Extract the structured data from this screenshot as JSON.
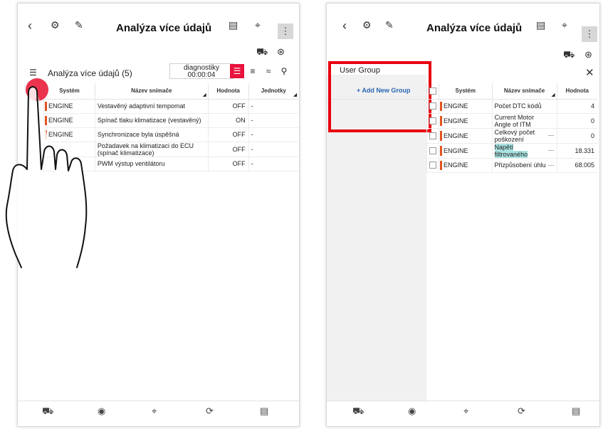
{
  "app": {
    "title": "Analýza více údajů"
  },
  "left": {
    "toolbar": {
      "section_label": "Analýza více údajů (5)",
      "diagnostics_label": "diagnostiky",
      "timer": "00:00:04"
    },
    "table": {
      "columns": [
        "Systém",
        "Název snímače",
        "Hodnota",
        "Jednotky"
      ],
      "rows": [
        {
          "system": "ENGINE",
          "sensor": "Vestavěný adaptivní tempomat",
          "value": "OFF",
          "unit": "-"
        },
        {
          "system": "ENGINE",
          "sensor": "Spínač tlaku klimatizace (vestavěný)",
          "value": "ON",
          "unit": "-"
        },
        {
          "system": "ENGINE",
          "sensor": "Synchronizace byla úspěšná",
          "value": "OFF",
          "unit": "-"
        },
        {
          "system": "",
          "sensor": "Požadavek na klimatizaci do ECU (spínač klimatizace)",
          "value": "OFF",
          "unit": "-"
        },
        {
          "system": "",
          "sensor": "PWM výstup ventilátoru",
          "value": "OFF",
          "unit": "-"
        }
      ]
    }
  },
  "right": {
    "user_group": {
      "title": "User Group",
      "add_label": "+ Add New Group"
    },
    "table": {
      "columns": [
        "Systém",
        "Název snímače",
        "Hodnota"
      ],
      "rows": [
        {
          "system": "ENGINE",
          "sensor": "Počet DTC kódů",
          "value": "4"
        },
        {
          "system": "ENGINE",
          "sensor": "Current Motor Angle of ITM",
          "value": "0"
        },
        {
          "system": "ENGINE",
          "sensor": "Celkový počet poškození",
          "value": "0"
        },
        {
          "system": "ENGINE",
          "sensor": "Napětí filtrovaného",
          "value": "18.331"
        },
        {
          "system": "ENGINE",
          "sensor": "Přizpůsobení úhlu",
          "value": "68.005"
        }
      ]
    }
  },
  "icons": {
    "back": "back-arrow-icon",
    "diagnostics": "diagnostic-gauge-icon",
    "export": "export-icon",
    "report": "report-icon",
    "fullscreen": "fullscreen-icon",
    "more": "more-vertical-icon",
    "vehicle": "vehicle-icon",
    "wave": "waveform-icon",
    "list": "list-check-icon",
    "search": "search-icon",
    "close": "close-icon",
    "record": "record-icon",
    "refresh": "refresh-icon",
    "checklist": "checklist-icon"
  },
  "colors": {
    "accent": "#e8123c",
    "engine_marker": "#e2531f",
    "link": "#2a66b3",
    "highlight_cell": "#a9e3e1",
    "annotation": "#e8000f"
  }
}
